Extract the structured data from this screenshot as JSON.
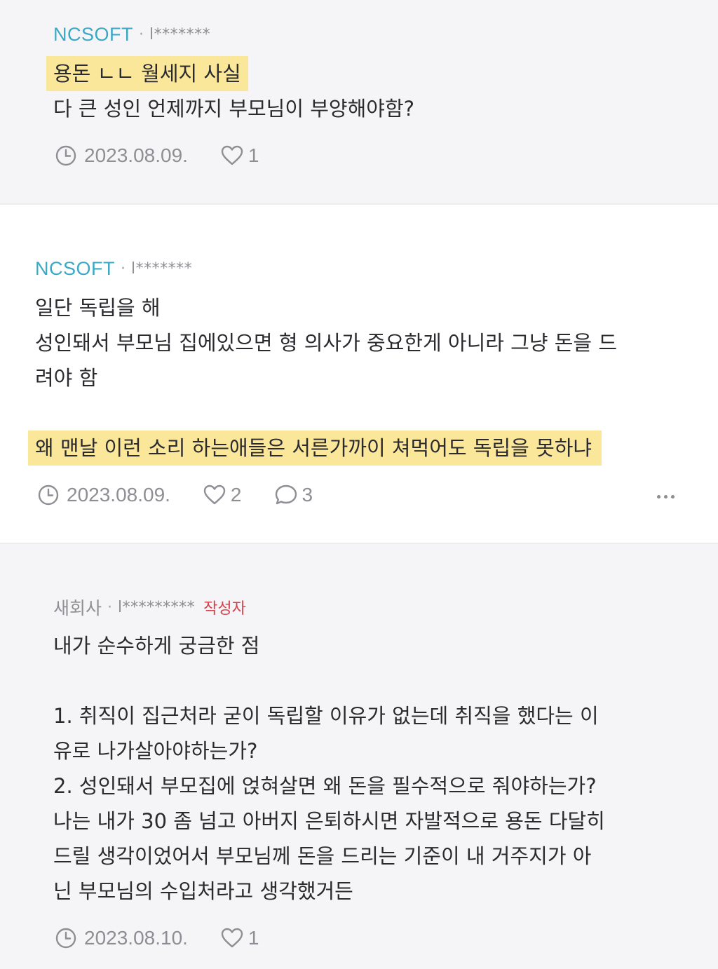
{
  "comments": [
    {
      "company": "NCSOFT",
      "separator": "·",
      "user": "l*******",
      "lines": [
        "용돈 ㄴㄴ 월세지 사실",
        "다 큰 성인 언제까지 부모님이 부양해야함?"
      ],
      "date": "2023.08.09.",
      "likes": "1"
    },
    {
      "company": "NCSOFT",
      "separator": "·",
      "user": "l*******",
      "lines": [
        "일단 독립을 해",
        "성인돼서 부모님 집에있으면 형 의사가 중요한게 아니라 그냥 돈을 드",
        "려야 함",
        "",
        "왜 맨날 이런 소리 하는애들은 서른가까이 쳐먹어도 독립을 못하냐"
      ],
      "date": "2023.08.09.",
      "likes": "2",
      "replies": "3"
    },
    {
      "company": "새회사",
      "separator": "·",
      "user": "l*********",
      "author_badge": "작성자",
      "lines": [
        "내가 순수하게 궁금한 점",
        "",
        "1. 취직이 집근처라 굳이 독립할 이유가 없는데 취직을 했다는 이",
        "유로 나가살아야하는가?",
        "2. 성인돼서 부모집에 얹혀살면 왜 돈을 필수적으로 줘야하는가?",
        "나는 내가 30 좀 넘고 아버지 은퇴하시면 자발적으로 용돈 다달히",
        "드릴 생각이었어서 부모님께 돈을 드리는 기준이 내 거주지가 아",
        "닌 부모님의 수입처라고 생각했거든"
      ],
      "date": "2023.08.10.",
      "likes": "1"
    }
  ],
  "icons": {
    "date": "clock-icon",
    "likes": "heart-icon",
    "replies": "speech-bubble-icon",
    "more": "more-options-icon"
  },
  "colors": {
    "company": "#3ba9c6",
    "highlight": "#fbe79a",
    "author_badge": "#d0434c",
    "meta": "#8e8e94"
  }
}
